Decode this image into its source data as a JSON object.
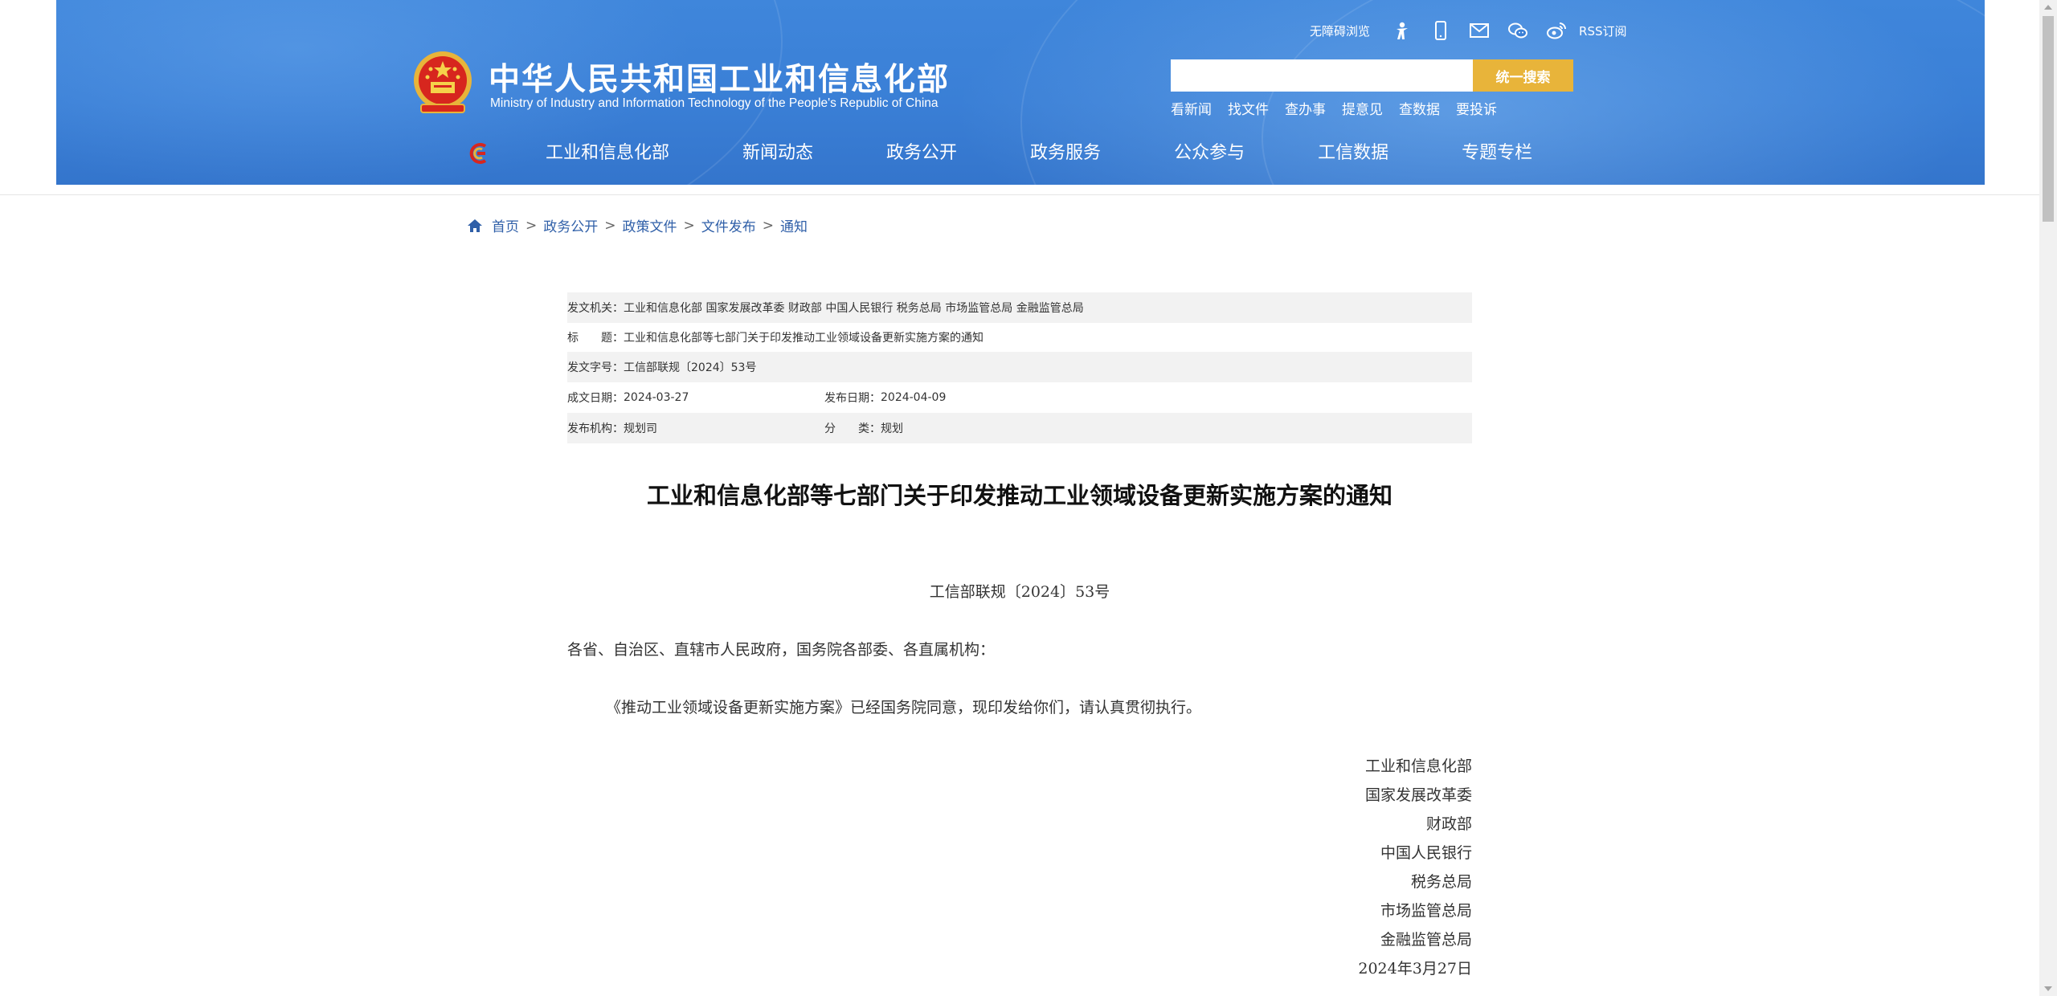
{
  "header": {
    "title": "中华人民共和国工业和信息化部",
    "subtitle": "Ministry of Industry and Information Technology of the People's Republic of China",
    "accessibility_label": "无障碍浏览",
    "rss_label": "RSS订阅",
    "tool_icons": [
      "accessibility-icon",
      "mobile-icon",
      "mail-icon",
      "wechat-icon",
      "weibo-icon"
    ],
    "search": {
      "placeholder": "",
      "button_label": "统一搜索"
    },
    "quick_links": [
      "看新闻",
      "找文件",
      "查办事",
      "提意见",
      "查数据",
      "要投诉"
    ],
    "nav": [
      "工业和信息化部",
      "新闻动态",
      "政务公开",
      "政务服务",
      "公众参与",
      "工信数据",
      "专题专栏"
    ],
    "colors": {
      "banner": "#3a7fd6",
      "search_button": "#e8b43a"
    }
  },
  "breadcrumb": [
    "首页",
    "政务公开",
    "政策文件",
    "文件发布",
    "通知"
  ],
  "meta": {
    "issuer_label": "发文机关：",
    "issuer": "工业和信息化部 国家发展改革委 财政部 中国人民银行 税务总局 市场监管总局 金融监管总局",
    "title_label": "标　　题：",
    "title": "工业和信息化部等七部门关于印发推动工业领域设备更新实施方案的通知",
    "number_label": "发文字号：",
    "number": "工信部联规〔2024〕53号",
    "created_label": "成文日期：",
    "created": "2024-03-27",
    "published_label": "发布日期：",
    "published": "2024-04-09",
    "office_label": "发布机构：",
    "office": "规划司",
    "category_label": "分　　类：",
    "category": "规划"
  },
  "article": {
    "title": "工业和信息化部等七部门关于印发推动工业领域设备更新实施方案的通知",
    "doc_number": "工信部联规〔2024〕53号",
    "salutation": "各省、自治区、直辖市人民政府，国务院各部委、各直属机构：",
    "body": "《推动工业领域设备更新实施方案》已经国务院同意，现印发给你们，请认真贯彻执行。",
    "signers": [
      "工业和信息化部",
      "国家发展改革委",
      "财政部",
      "中国人民银行",
      "税务总局",
      "市场监管总局",
      "金融监管总局"
    ],
    "date": "2024年3月27日"
  }
}
